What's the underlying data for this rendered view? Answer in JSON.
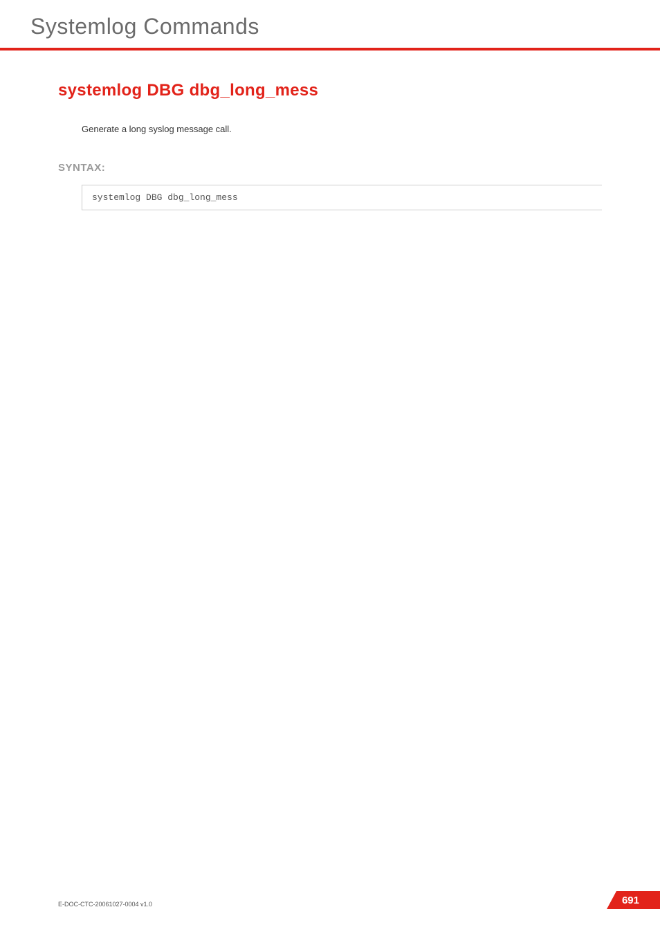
{
  "header": {
    "title": "Systemlog Commands"
  },
  "main": {
    "command_title": "systemlog DBG dbg_long_mess",
    "description": "Generate a long syslog message call.",
    "syntax_label": "SYNTAX:",
    "code": "systemlog DBG dbg_long_mess"
  },
  "footer": {
    "doc_id": "E-DOC-CTC-20061027-0004 v1.0",
    "page_number": "691"
  }
}
